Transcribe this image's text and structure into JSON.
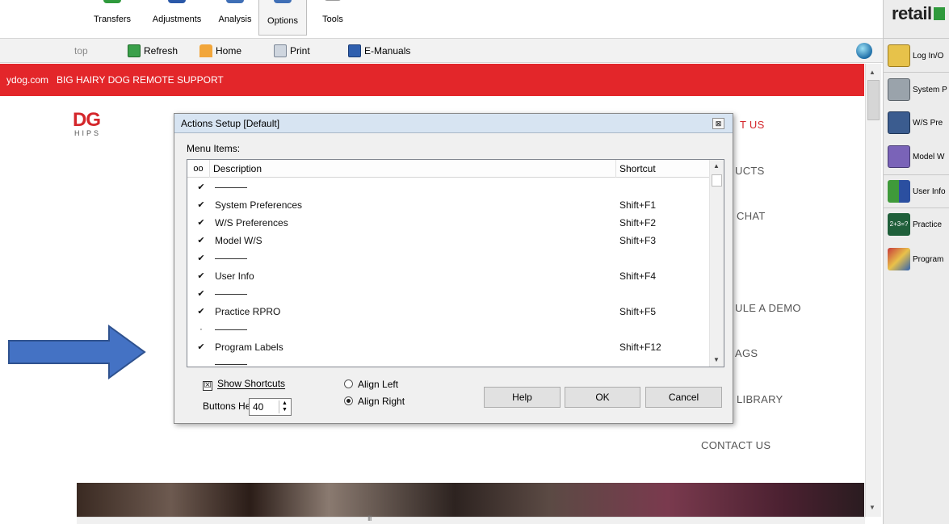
{
  "ribbon": {
    "tabs": [
      {
        "label": "Transfers",
        "color": "#2f9a3c"
      },
      {
        "label": "Adjustments",
        "color": "#2a58a8"
      },
      {
        "label": "Analysis",
        "color": "#3f6fb6"
      },
      {
        "label": "Options",
        "color": "#3f6fb6"
      },
      {
        "label": "Tools",
        "color": "#9a9a9a"
      }
    ]
  },
  "toolbar": {
    "partial_label": "top",
    "refresh_label": "Refresh",
    "home_label": "Home",
    "print_label": "Print",
    "emanuals_label": "E-Manuals"
  },
  "browser": {
    "red_bar_text": "ydog.com   BIG HAIRY DOG REMOTE SUPPORT",
    "logo_big": "DG",
    "logo_small": "HIPS",
    "nav": [
      "T US",
      "UCTS",
      "CHAT",
      "ULE A DEMO",
      "AGS",
      "LIBRARY",
      "CONTACT US"
    ],
    "hscroll_grip": "III"
  },
  "right_panel": {
    "logo_text": "retail",
    "items": [
      "Log In/O",
      "System P",
      "W/S Pre",
      "Model W",
      "User Info",
      "Practice",
      "Program"
    ],
    "practice_icon_text": "2+3=?"
  },
  "dialog": {
    "title": "Actions Setup [Default]",
    "close_glyph": "⊠",
    "menu_items_label": "Menu Items:",
    "columns": {
      "description": "Description",
      "shortcut": "Shortcut"
    },
    "rows": [
      {
        "check": "✔",
        "separator": true,
        "description": "",
        "shortcut": ""
      },
      {
        "check": "✔",
        "separator": false,
        "description": "System Preferences",
        "shortcut": "Shift+F1"
      },
      {
        "check": "✔",
        "separator": false,
        "description": "W/S Preferences",
        "shortcut": "Shift+F2"
      },
      {
        "check": "✔",
        "separator": false,
        "description": "Model W/S",
        "shortcut": "Shift+F3"
      },
      {
        "check": "✔",
        "separator": true,
        "description": "",
        "shortcut": ""
      },
      {
        "check": "✔",
        "separator": false,
        "description": "User Info",
        "shortcut": "Shift+F4"
      },
      {
        "check": "✔",
        "separator": true,
        "description": "",
        "shortcut": ""
      },
      {
        "check": "✔",
        "separator": false,
        "description": "Practice RPRO",
        "shortcut": "Shift+F5"
      },
      {
        "check": "·",
        "separator": true,
        "description": "",
        "shortcut": ""
      },
      {
        "check": "✔",
        "separator": false,
        "description": "Program Labels",
        "shortcut": "Shift+F12"
      },
      {
        "check": "",
        "separator": true,
        "description": "",
        "shortcut": ""
      }
    ],
    "show_shortcuts_label": "Show Shortcuts",
    "show_shortcuts_checked": "☒",
    "buttons_height_label": "Buttons Height:",
    "buttons_height_value": "40",
    "align_left_label": "Align Left",
    "align_right_label": "Align Right",
    "help_label": "Help",
    "ok_label": "OK",
    "cancel_label": "Cancel"
  },
  "annotation": {
    "arrow_color": "#4472c4"
  }
}
